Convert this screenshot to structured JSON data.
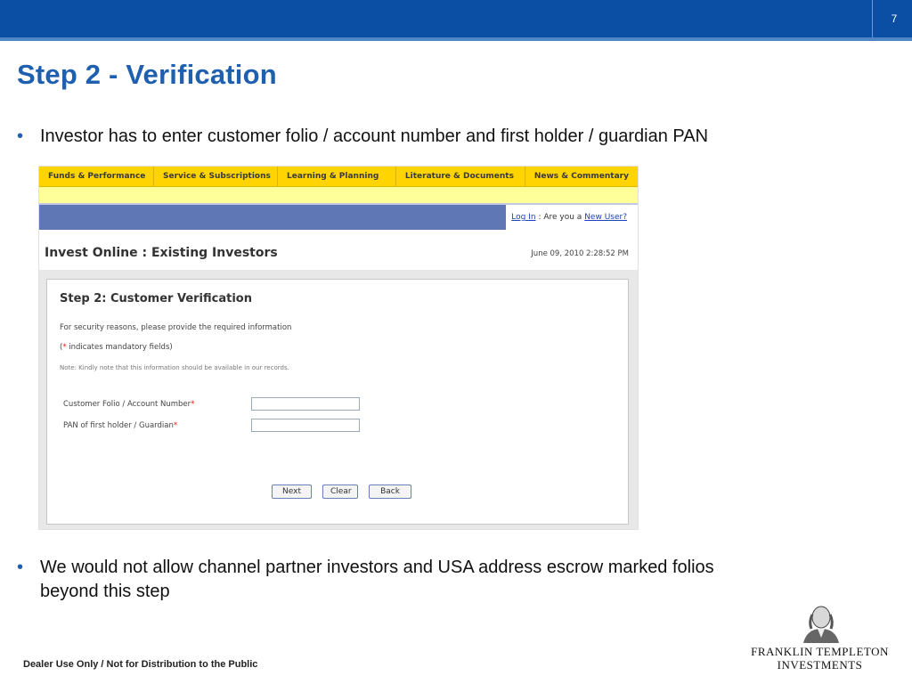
{
  "slide": {
    "page_number": "7",
    "title": "Step 2 - Verification",
    "bullet1": "Investor has to enter customer folio / account number and first holder / guardian PAN",
    "bullet2_line1": "We would not allow channel partner investors and USA address escrow marked folios",
    "bullet2_line2": "beyond this step",
    "footer": "Dealer Use Only / Not for Distribution to the Public",
    "logo_line1": "FRANKLIN TEMPLETON",
    "logo_line2": "INVESTMENTS"
  },
  "screenshot": {
    "nav": [
      {
        "label": "Funds & Performance"
      },
      {
        "label": "Service & Subscriptions"
      },
      {
        "label": "Learning & Planning"
      },
      {
        "label": "Literature & Documents"
      },
      {
        "label": "News & Commentary"
      }
    ],
    "login": {
      "login_link": "Log In",
      "prompt": ": Are you a",
      "new_user_link": "New User?"
    },
    "page_title": "Invest Online : Existing Investors",
    "timestamp": "June 09, 2010 2:28:52 PM",
    "step_title": "Step 2: Customer Verification",
    "info_line1": "For security reasons, please provide the required information",
    "info_line2_open": "(",
    "info_line2_star": "*",
    "info_line2_rest": " indicates mandatory fields)",
    "note": "Note: Kindly note that this information should be available in our records.",
    "fields": [
      {
        "label": "Customer Folio / Account Number",
        "required_mark": "*",
        "value": ""
      },
      {
        "label": "PAN of first holder / Guardian",
        "required_mark": "*",
        "value": ""
      }
    ],
    "buttons": {
      "next": "Next",
      "clear": "Clear",
      "back": "Back"
    }
  },
  "colors": {
    "header_blue": "#0a4fa3",
    "title_blue": "#1f5fb0",
    "nav_yellow": "#ffd400",
    "bar_blue": "#6077b5"
  }
}
